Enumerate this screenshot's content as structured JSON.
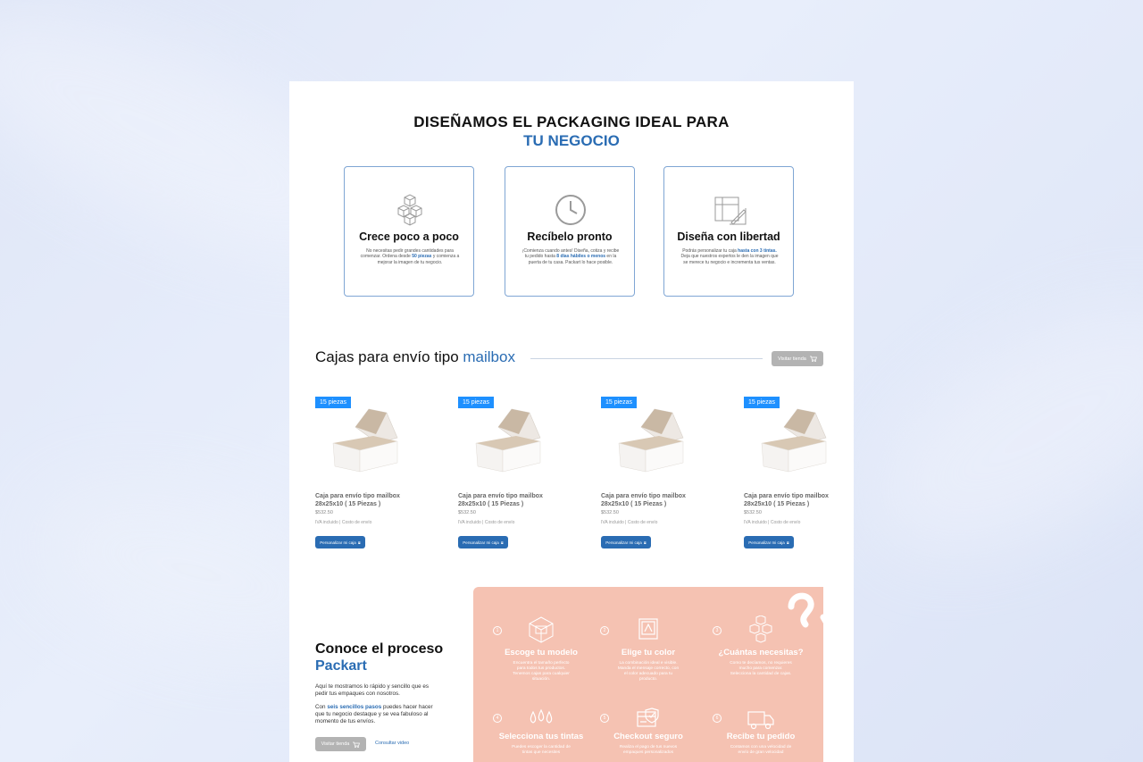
{
  "hero": {
    "line1": "DISEÑAMOS EL PACKAGING IDEAL PARA",
    "line2": "TU NEGOCIO"
  },
  "features": [
    {
      "icon": "boxes-icon",
      "title": "Crece poco a poco",
      "desc_pre": "No necesitas pedir grandes cantidades para comenzar. Ordena desde ",
      "desc_bold": "50 piezas",
      "desc_post": " y comienza a mejorar la imagen de tu negocio."
    },
    {
      "icon": "clock-icon",
      "title": "Recíbelo pronto",
      "desc_pre": "¡Comienza cuando antes! Diseña, cotiza y recibe tu pedido hasta ",
      "desc_bold": "8 días hábiles o menos",
      "desc_post": " en la puerta de tu casa. Packart lo hace posible."
    },
    {
      "icon": "design-tools-icon",
      "title": "Diseña con libertad",
      "desc_pre": "Podrás personalizar tu caja ",
      "desc_bold": "hasta con 3 tintas.",
      "desc_post": " Deja que nuestros expertos le den la imagen que se merece tu negocio e incrementa tus ventas."
    }
  ],
  "section": {
    "title_pre": "Cajas para envío tipo ",
    "title_hl": "mailbox",
    "store_button": "Visitar tienda"
  },
  "products": [
    {
      "badge": "15 piezas",
      "name": "Caja para envío tipo mailbox 28x25x10 ( 15 Piezas )",
      "price": "$532.50",
      "iva": "IVA incluido | Costo de envío",
      "cta": "Personalizar mi caja"
    },
    {
      "badge": "15 piezas",
      "name": "Caja para envío tipo mailbox 28x25x10 ( 15 Piezas )",
      "price": "$532.50",
      "iva": "IVA incluido | Costo de envío",
      "cta": "Personalizar mi caja"
    },
    {
      "badge": "15 piezas",
      "name": "Caja para envío tipo mailbox 28x25x10 ( 15 Piezas )",
      "price": "$532.50",
      "iva": "IVA incluido | Costo de envío",
      "cta": "Personalizar mi caja"
    },
    {
      "badge": "15 piezas",
      "name": "Caja para envío tipo mailbox 28x25x10 ( 15 Piezas )",
      "price": "$532.50",
      "iva": "IVA incluido | Costo de envío",
      "cta": "Personalizar mi caja"
    }
  ],
  "process": {
    "title1": "Conoce el proceso",
    "title2": "Packart",
    "p1": "Aquí te mostramos lo rápido y sencillo que es pedir tus empaques con nosotros.",
    "p2_pre": "Con ",
    "p2_bold": "seis sencillos pasos",
    "p2_post": " puedes hacer hacer que tu negocio destaque y se vea fabuloso al momento de tus envíos.",
    "store_button": "Visitar tienda",
    "video_link": "Consultar video"
  },
  "steps": [
    {
      "num": "1",
      "icon": "cube-icon",
      "title": "Escoge tu modelo",
      "desc": "Encuentra el tamaño perfecto para todos tus productos. Tenemos cajas para cualquier situación."
    },
    {
      "num": "2",
      "icon": "palette-icon",
      "title": "Elige tu color",
      "desc": "La combinación ideal e visible. Manda el mensaje correcto, con el color adecuado para tu producto."
    },
    {
      "num": "3",
      "icon": "boxes-stack-icon",
      "title": "¿Cuántas necesitas?",
      "desc": "Como te decíamos, no requieres mucho para comenzar. Selecciona la cantidad de cajas."
    },
    {
      "num": "4",
      "icon": "ink-drops-icon",
      "title": "Selecciona tus tintas",
      "desc": "Puedes escoger la cantidad de tintas que necesites"
    },
    {
      "num": "5",
      "icon": "secure-checkout-icon",
      "title": "Checkout seguro",
      "desc": "Realiza el pago de tus nuevos empaques personalizados"
    },
    {
      "num": "6",
      "icon": "truck-icon",
      "title": "Recibe tu pedido",
      "desc": "Contamos con una velocidad de envío de gran velocidad"
    }
  ],
  "colors": {
    "brand_blue": "#2a6cb3",
    "badge_blue": "#1e90ff",
    "salmon": "#f5c2b2"
  }
}
